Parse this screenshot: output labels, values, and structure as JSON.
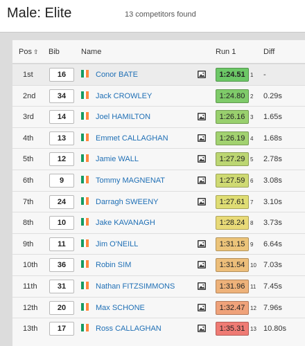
{
  "header": {
    "title": "Male: Elite",
    "count": "13 competitors found"
  },
  "table": {
    "columns": {
      "pos": "Pos",
      "bib": "Bib",
      "name": "Name",
      "run": "Run 1",
      "diff": "Diff"
    },
    "colors": {
      "flag_green": "#169b62",
      "flag_white": "#ffffff",
      "flag_orange": "#ff883e",
      "name_link": "#1f6fb5"
    },
    "rows": [
      {
        "pos": "1st",
        "bib": "16",
        "name": "Conor BATE",
        "time": "1:24.51",
        "rank": "1",
        "diff": "-",
        "color": "#6cc766",
        "video": true
      },
      {
        "pos": "2nd",
        "bib": "34",
        "name": "Jack CROWLEY",
        "time": "1:24.80",
        "rank": "2",
        "diff": "0.29s",
        "color": "#7fcb6a",
        "video": false
      },
      {
        "pos": "3rd",
        "bib": "14",
        "name": "Joel HAMILTON",
        "time": "1:26.16",
        "rank": "3",
        "diff": "1.65s",
        "color": "#99d06e",
        "video": true
      },
      {
        "pos": "4th",
        "bib": "13",
        "name": "Emmet CALLAGHAN",
        "time": "1:26.19",
        "rank": "4",
        "diff": "1.68s",
        "color": "#a2d270",
        "video": true
      },
      {
        "pos": "5th",
        "bib": "12",
        "name": "Jamie WALL",
        "time": "1:27.29",
        "rank": "5",
        "diff": "2.78s",
        "color": "#bcd672",
        "video": true
      },
      {
        "pos": "6th",
        "bib": "9",
        "name": "Tommy MAGNENAT",
        "time": "1:27.59",
        "rank": "6",
        "diff": "3.08s",
        "color": "#cfda73",
        "video": true
      },
      {
        "pos": "7th",
        "bib": "24",
        "name": "Darragh SWEENY",
        "time": "1:27.61",
        "rank": "7",
        "diff": "3.10s",
        "color": "#dfdd74",
        "video": true
      },
      {
        "pos": "8th",
        "bib": "10",
        "name": "Jake KAVANAGH",
        "time": "1:28.24",
        "rank": "8",
        "diff": "3.73s",
        "color": "#e8da78",
        "video": false
      },
      {
        "pos": "9th",
        "bib": "11",
        "name": "Jim O'NEILL",
        "time": "1:31.15",
        "rank": "9",
        "diff": "6.64s",
        "color": "#ecc47a",
        "video": true
      },
      {
        "pos": "10th",
        "bib": "36",
        "name": "Robin SIM",
        "time": "1:31.54",
        "rank": "10",
        "diff": "7.03s",
        "color": "#edbe7a",
        "video": true
      },
      {
        "pos": "11th",
        "bib": "31",
        "name": "Nathan FITZSIMMONS",
        "time": "1:31.96",
        "rank": "11",
        "diff": "7.45s",
        "color": "#eeb27a",
        "video": true
      },
      {
        "pos": "12th",
        "bib": "20",
        "name": "Max SCHONE",
        "time": "1:32.47",
        "rank": "12",
        "diff": "7.96s",
        "color": "#efa27a",
        "video": true
      },
      {
        "pos": "13th",
        "bib": "17",
        "name": "Ross CALLAGHAN",
        "time": "1:35.31",
        "rank": "13",
        "diff": "10.80s",
        "color": "#ef7b74",
        "video": true
      }
    ]
  }
}
